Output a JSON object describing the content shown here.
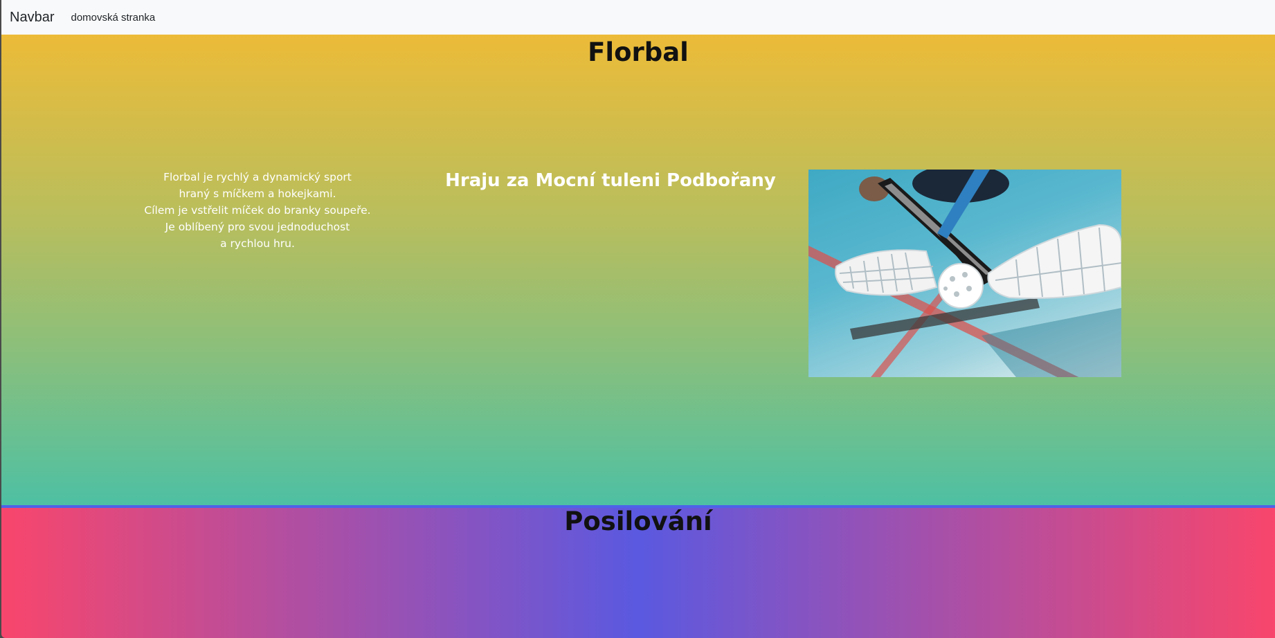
{
  "navbar": {
    "brand": "Navbar",
    "links": [
      "domovská stranka"
    ]
  },
  "florbal": {
    "title": "Florbal",
    "description_lines": [
      "Florbal je rychlý a dynamický sport",
      "hraný s míčkem a hokejkami.",
      "Cílem je vstřelit míček do branky soupeře.",
      "Je oblíbený pro svou jednoduchost",
      "a rychlou hru."
    ],
    "team_heading": "Hraju za Mocní tuleni Podbořany",
    "photo_alt": "floorball sticks and ball on court"
  },
  "posilovani": {
    "title": "Posilování"
  },
  "colors": {
    "navbar_bg": "#f8f9fa",
    "florbal_gradient_top": "#ecbb38",
    "florbal_gradient_bottom": "#4ec0a3",
    "posil_gradient_edge": "#f8466c",
    "posil_gradient_center": "#5a59e0"
  }
}
